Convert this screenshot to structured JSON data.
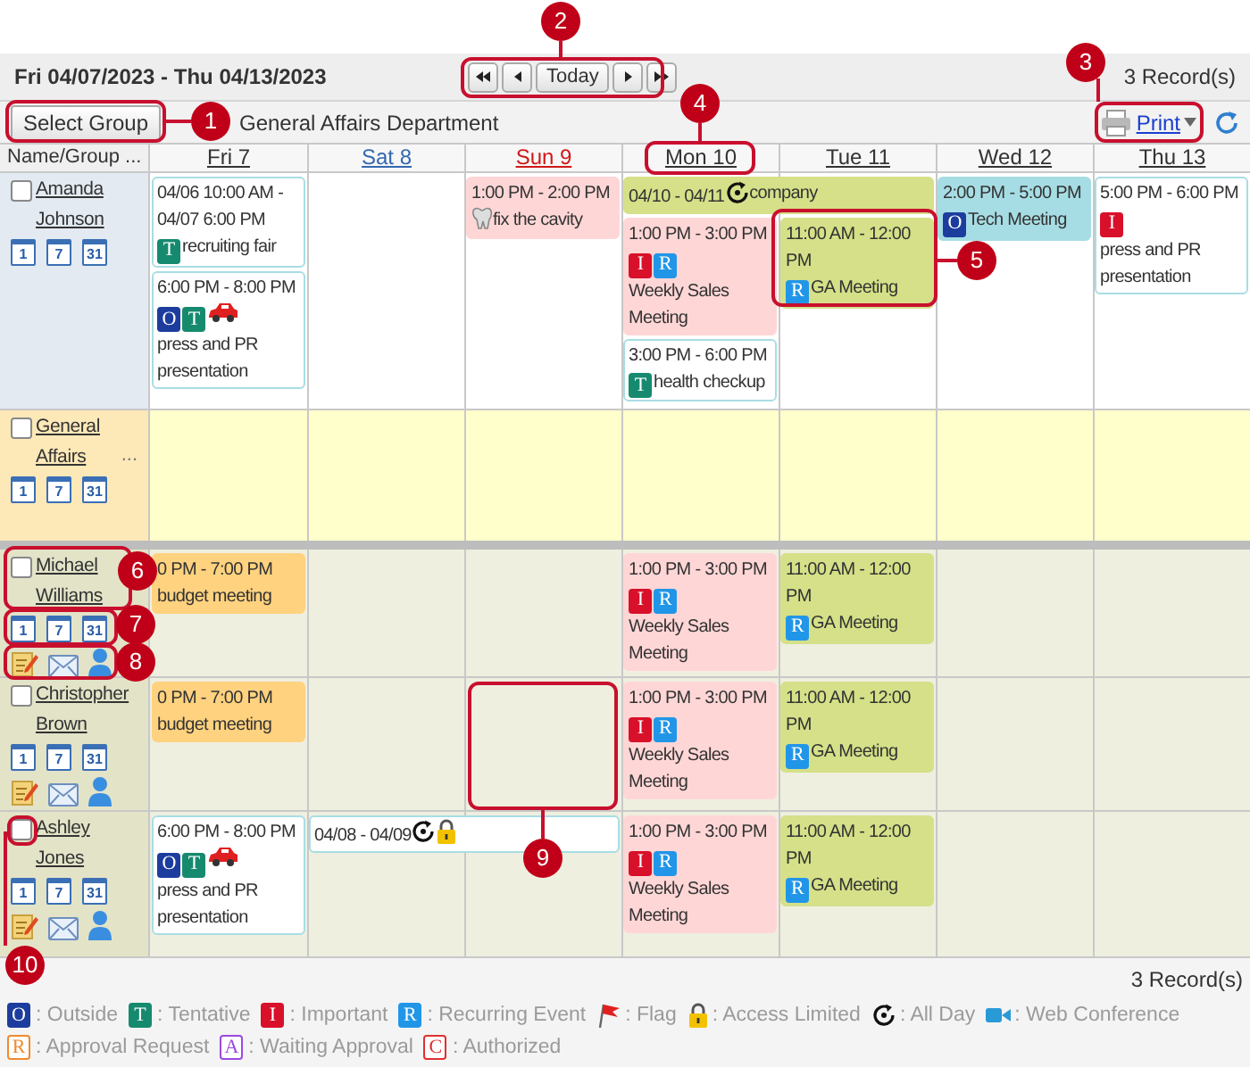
{
  "header": {
    "date_range": "Fri 04/07/2023 - Thu 04/13/2023",
    "nav": [
      {
        "kind": "first"
      },
      {
        "kind": "prev"
      },
      {
        "kind": "today",
        "label": "Today"
      },
      {
        "kind": "next"
      },
      {
        "kind": "last"
      }
    ],
    "record_count": "3 Record(s)"
  },
  "toolbar": {
    "select_group": "Select Group",
    "group_name": "General Affairs Department",
    "print": "Print"
  },
  "name_column": "Name/Group ...",
  "days": [
    {
      "label": "Fri 7",
      "kind": "weekday"
    },
    {
      "label": "Sat 8",
      "kind": "saturday"
    },
    {
      "label": "Sun 9",
      "kind": "sunday"
    },
    {
      "label": "Mon 10",
      "kind": "weekday"
    },
    {
      "label": "Tue 11",
      "kind": "weekday"
    },
    {
      "label": "Wed 12",
      "kind": "weekday"
    },
    {
      "label": "Thu 13",
      "kind": "weekday"
    }
  ],
  "rows": [
    {
      "kind": "self",
      "name": "Amanda Johnson",
      "checked": false,
      "views": [
        "1",
        "7",
        "31"
      ],
      "span_events": [
        {
          "color": "#d5e088",
          "time": "04/10 - 04/11",
          "marks": [
            {
              "kind": "allday"
            }
          ],
          "title": "company"
        }
      ],
      "days": {
        "fri": [
          {
            "color": "#ffffff",
            "time": "04/06 10:00 AM - 04/07 6:00 PM",
            "marks": [
              {
                "kind": "tentative",
                "label": "T"
              }
            ],
            "title": "recruiting fair"
          },
          {
            "color": "#ffffff",
            "time": "6:00 PM - 8:00 PM",
            "marks": [
              {
                "kind": "outside",
                "label": "O"
              },
              {
                "kind": "tentative",
                "label": "T"
              },
              {
                "kind": "car"
              }
            ],
            "title": "press and PR presentation"
          }
        ],
        "sun": [
          {
            "color": "#ffd6d6",
            "time": "1:00 PM - 2:00 PM",
            "marks": [
              {
                "kind": "tooth"
              }
            ],
            "title": "fix the cavity"
          }
        ],
        "mon": [
          {
            "color": "#ffd6d6",
            "time": "1:00 PM - 3:00 PM",
            "marks": [
              {
                "kind": "important",
                "label": "I"
              },
              {
                "kind": "recurring",
                "label": "R"
              }
            ],
            "title": "Weekly Sales Meeting"
          },
          {
            "color": "#ffffff",
            "time": "3:00 PM - 6:00 PM",
            "marks": [
              {
                "kind": "tentative",
                "label": "T"
              }
            ],
            "title": "health checkup"
          }
        ],
        "tue": [
          {
            "color": "#d5e088",
            "time": "11:00 AM - 12:00 PM",
            "marks": [
              {
                "kind": "recurring",
                "label": "R"
              }
            ],
            "title": "GA Meeting"
          }
        ],
        "wed": [
          {
            "color": "#a6dde4",
            "time": "2:00 PM - 5:00 PM",
            "marks": [
              {
                "kind": "outside",
                "label": "O"
              }
            ],
            "title": "Tech Meeting"
          }
        ],
        "thu": [
          {
            "color": "#ffffff",
            "time": "5:00 PM - 6:00 PM",
            "marks": [
              {
                "kind": "important",
                "label": "I"
              }
            ],
            "title": "press and PR presentation"
          }
        ]
      }
    },
    {
      "kind": "group",
      "name": "General Affairs",
      "more": "...",
      "checked": false,
      "views": [
        "1",
        "7",
        "31"
      ]
    },
    {
      "kind": "member",
      "name": "Michael Williams",
      "checked": false,
      "views": [
        "1",
        "7",
        "31"
      ],
      "days": {
        "fri": [
          {
            "color": "#ffd27f",
            "time": "0 PM - 7:00 PM",
            "title": "budget meeting"
          }
        ],
        "mon": [
          {
            "color": "#ffd6d6",
            "time": "1:00 PM - 3:00 PM",
            "marks": [
              {
                "kind": "important",
                "label": "I"
              },
              {
                "kind": "recurring",
                "label": "R"
              }
            ],
            "title": "Weekly Sales Meeting"
          }
        ],
        "tue": [
          {
            "color": "#d5e088",
            "time": "11:00 AM - 12:00 PM",
            "marks": [
              {
                "kind": "recurring",
                "label": "R"
              }
            ],
            "title": "GA Meeting"
          }
        ]
      }
    },
    {
      "kind": "member",
      "name": "Christopher Brown",
      "checked": false,
      "views": [
        "1",
        "7",
        "31"
      ],
      "days": {
        "fri": [
          {
            "color": "#ffd27f",
            "time": "0 PM - 7:00 PM",
            "title": "budget meeting"
          }
        ],
        "mon": [
          {
            "color": "#ffd6d6",
            "time": "1:00 PM - 3:00 PM",
            "marks": [
              {
                "kind": "important",
                "label": "I"
              },
              {
                "kind": "recurring",
                "label": "R"
              }
            ],
            "title": "Weekly Sales Meeting"
          }
        ],
        "tue": [
          {
            "color": "#d5e088",
            "time": "11:00 AM - 12:00 PM",
            "marks": [
              {
                "kind": "recurring",
                "label": "R"
              }
            ],
            "title": "GA Meeting"
          }
        ]
      }
    },
    {
      "kind": "member",
      "name": "Ashley Jones",
      "checked": false,
      "views": [
        "1",
        "7",
        "31"
      ],
      "span_events": [
        {
          "color": "#ffffff",
          "time": "04/08 - 04/09",
          "marks": [
            {
              "kind": "allday"
            },
            {
              "kind": "lock"
            }
          ]
        }
      ],
      "days": {
        "fri": [
          {
            "color": "#ffffff",
            "time": "6:00 PM - 8:00 PM",
            "marks": [
              {
                "kind": "outside",
                "label": "O"
              },
              {
                "kind": "tentative",
                "label": "T"
              },
              {
                "kind": "car"
              }
            ],
            "title": "press and PR presentation"
          }
        ],
        "mon": [
          {
            "color": "#ffd6d6",
            "time": "1:00 PM - 3:00 PM",
            "marks": [
              {
                "kind": "important",
                "label": "I"
              },
              {
                "kind": "recurring",
                "label": "R"
              }
            ],
            "title": "Weekly Sales Meeting"
          }
        ],
        "tue": [
          {
            "color": "#d5e088",
            "time": "11:00 AM - 12:00 PM",
            "marks": [
              {
                "kind": "recurring",
                "label": "R"
              }
            ],
            "title": "GA Meeting"
          }
        ]
      }
    }
  ],
  "footer_count": "3 Record(s)",
  "legend": [
    [
      {
        "kind": "outside",
        "label": "O",
        "text": ": Outside"
      },
      {
        "kind": "tentative",
        "label": "T",
        "text": ": Tentative"
      },
      {
        "kind": "important",
        "label": "I",
        "text": ": Important"
      },
      {
        "kind": "recurring",
        "label": "R",
        "text": ": Recurring Event"
      },
      {
        "kind": "flag",
        "text": ": Flag"
      },
      {
        "kind": "lock",
        "text": ": Access Limited"
      },
      {
        "kind": "allday",
        "text": ": All Day"
      },
      {
        "kind": "video",
        "text": ": Web Conference"
      }
    ],
    [
      {
        "kind": "approval_request",
        "label": "R",
        "text": ": Approval Request"
      },
      {
        "kind": "waiting",
        "label": "A",
        "text": ": Waiting Approval"
      },
      {
        "kind": "authorized",
        "label": "C",
        "text": ": Authorized"
      }
    ]
  ],
  "callouts": [
    {
      "number": "1"
    },
    {
      "number": "2"
    },
    {
      "number": "3"
    },
    {
      "number": "4"
    },
    {
      "number": "5"
    },
    {
      "number": "6"
    },
    {
      "number": "7"
    },
    {
      "number": "8"
    },
    {
      "number": "9"
    },
    {
      "number": "10"
    }
  ]
}
